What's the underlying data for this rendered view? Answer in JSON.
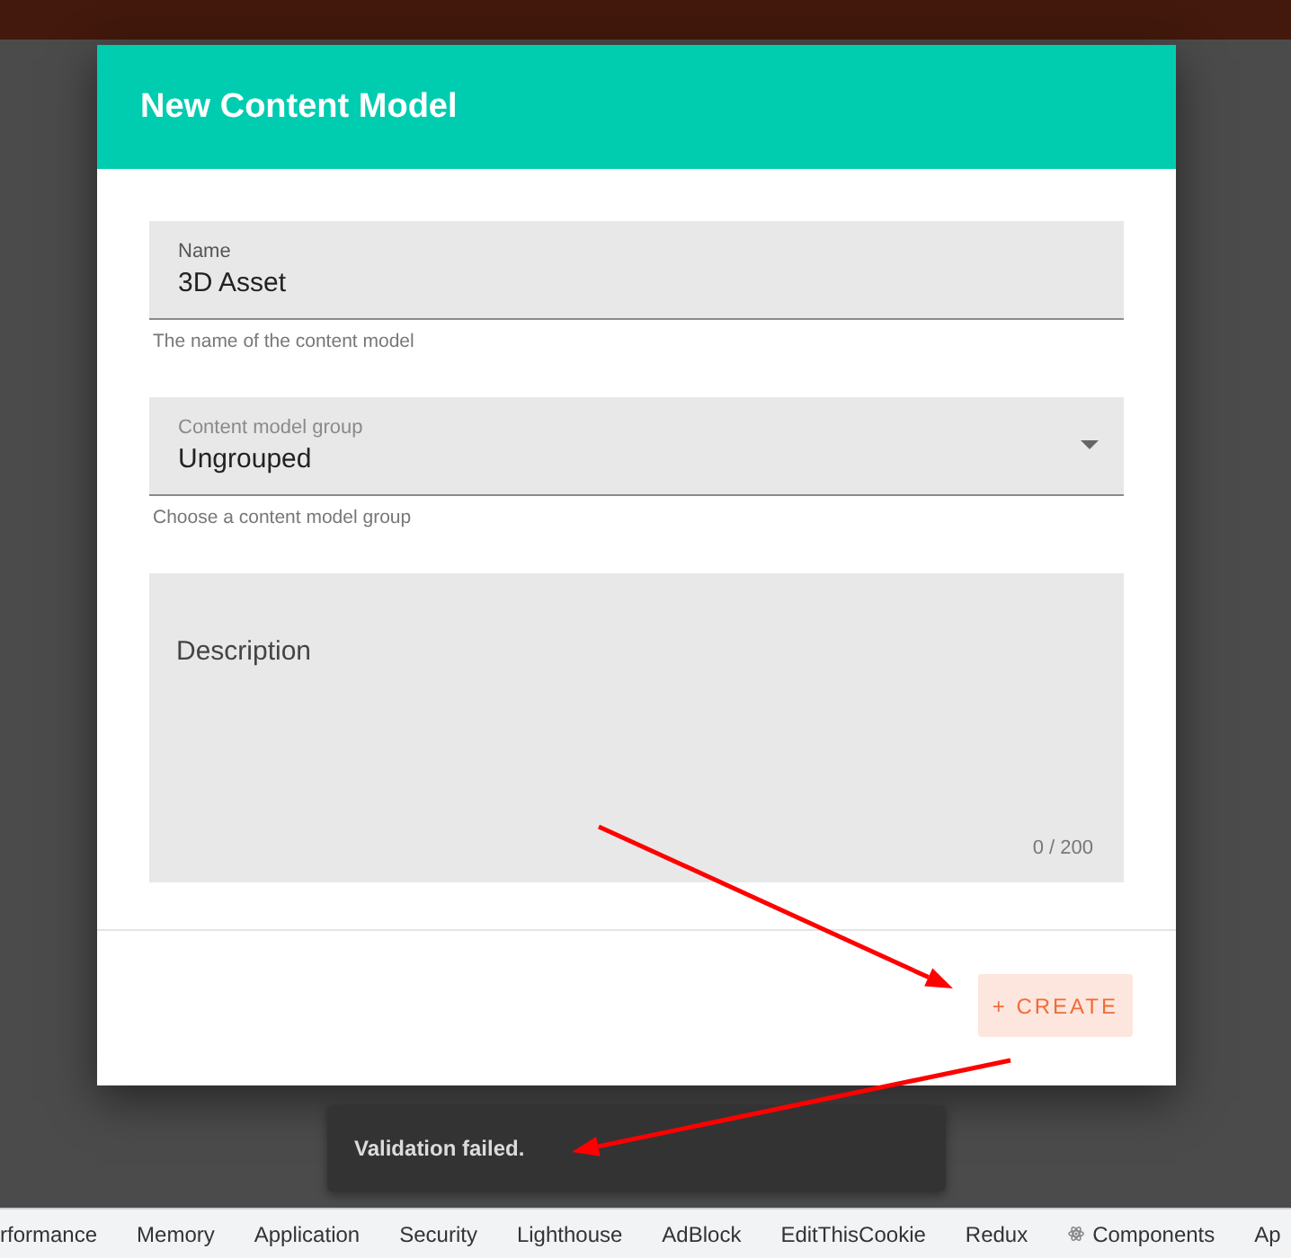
{
  "dialog": {
    "title": "New Content Model",
    "fields": [
      {
        "kind": "text",
        "label": "Name",
        "value": "3D Asset",
        "helper": "The name of the content model"
      },
      {
        "kind": "select",
        "label": "Content model group",
        "value": "Ungrouped",
        "helper": "Choose a content model group"
      },
      {
        "kind": "textarea",
        "label": "Description",
        "counter": "0 / 200"
      }
    ],
    "actions": [
      {
        "kind": "create",
        "label": "+ CREATE"
      }
    ]
  },
  "snackbar": {
    "message": "Validation failed."
  },
  "devtools_tabs": [
    {
      "label": "rformance",
      "kind": "plain",
      "selected": false
    },
    {
      "label": "Memory",
      "kind": "plain",
      "selected": false
    },
    {
      "label": "Application",
      "kind": "plain",
      "selected": false
    },
    {
      "label": "Security",
      "kind": "plain",
      "selected": false
    },
    {
      "label": "Lighthouse",
      "kind": "plain",
      "selected": false
    },
    {
      "label": "AdBlock",
      "kind": "plain",
      "selected": false
    },
    {
      "label": "EditThisCookie",
      "kind": "plain",
      "selected": false
    },
    {
      "label": "Redux",
      "kind": "plain",
      "selected": false
    },
    {
      "label": "Components",
      "kind": "icon",
      "selected": false
    },
    {
      "label": "Ap",
      "kind": "plain",
      "selected": false
    }
  ],
  "annotations": [
    {
      "kind": "arrow"
    },
    {
      "kind": "arrow"
    }
  ]
}
